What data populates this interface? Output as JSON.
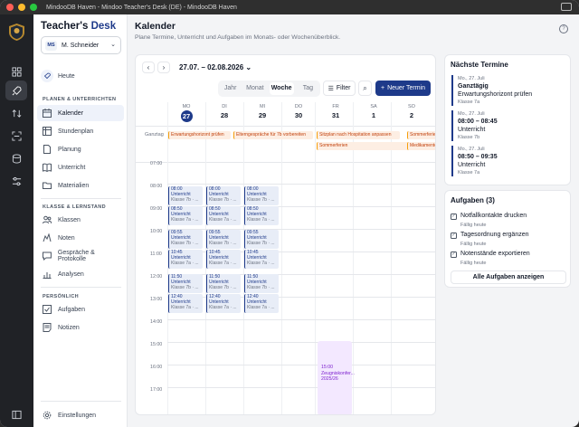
{
  "window": {
    "title": "MindooDB Haven - Mindoo Teacher's Desk (DE) - MindooDB Haven"
  },
  "sidebar": {
    "brand_plain": "Teacher's ",
    "brand_accent": "Desk",
    "user": {
      "initials": "MS",
      "name": "M. Schneider"
    },
    "home_label": "Heute",
    "sections": [
      {
        "title": "PLANEN & UNTERRICHTEN",
        "items": [
          "Kalender",
          "Stundenplan",
          "Planung",
          "Unterricht",
          "Materialien"
        ]
      },
      {
        "title": "KLASSE & LERNSTAND",
        "items": [
          "Klassen",
          "Noten",
          "Gespräche & Protokolle",
          "Analysen"
        ]
      },
      {
        "title": "PERSÖNLICH",
        "items": [
          "Aufgaben",
          "Notizen"
        ]
      }
    ],
    "settings_label": "Einstellungen"
  },
  "header": {
    "title": "Kalender",
    "subtitle": "Plane Termine, Unterricht und Aufgaben im Monats- oder Wochenüberblick."
  },
  "calendar": {
    "date_range": "27.07. – 02.08.2026",
    "views": [
      "Jahr",
      "Monat",
      "Woche",
      "Tag"
    ],
    "active_view": "Woche",
    "filter_label": "Filter",
    "new_label": "Neuer Termin",
    "allday_label": "Ganztag",
    "days": [
      {
        "name": "MO",
        "date": "27",
        "today": true
      },
      {
        "name": "DI",
        "date": "28"
      },
      {
        "name": "MI",
        "date": "29"
      },
      {
        "name": "DO",
        "date": "30"
      },
      {
        "name": "FR",
        "date": "31"
      },
      {
        "name": "SA",
        "date": "1"
      },
      {
        "name": "SO",
        "date": "2"
      }
    ],
    "allday_events": [
      "Erwartungshorizont prüfen",
      "Elterngespräche für 7b vorbereiten",
      "Sitzplan nach Hospitation anpassen",
      "Sommerferien",
      "Sommerferien",
      "Medikamente"
    ],
    "times": [
      "07:00",
      "08:00",
      "09:00",
      "10:00",
      "11:00",
      "12:00",
      "13:00",
      "14:00",
      "15:00",
      "16:00",
      "17:00"
    ],
    "lesson": {
      "title": "Unterricht",
      "times": [
        "08:00",
        "08:50",
        "09:55",
        "10:45",
        "11:50",
        "12:40"
      ],
      "class_prefix": "Klasse 7"
    },
    "purple_event": {
      "time": "15:00",
      "title": "Zeugniskonfer...",
      "year": "2025/26"
    }
  },
  "upcoming": {
    "title": "Nächste Termine",
    "items": [
      {
        "date": "Mo., 27. Juli",
        "time": "Ganztägig",
        "title": "Erwartungshorizont prüfen",
        "class": "Klasse 7a"
      },
      {
        "date": "Mo., 27. Juli",
        "time": "08:00 – 08:45",
        "title": "Unterricht",
        "class": "Klasse 7b"
      },
      {
        "date": "Mo., 27. Juli",
        "time": "08:50 – 09:35",
        "title": "Unterricht",
        "class": "Klasse 7a"
      }
    ]
  },
  "tasks": {
    "title": "Aufgaben (3)",
    "items": [
      {
        "title": "Notfallkontakte drucken",
        "due": "Fällig heute"
      },
      {
        "title": "Tagesordnung ergänzen",
        "due": "Fällig heute"
      },
      {
        "title": "Notenstände exportieren",
        "due": "Fällig heute"
      }
    ],
    "all_label": "Alle Aufgaben anzeigen"
  },
  "colors": {
    "accent": "#1e3a8a",
    "lesson_bg": "#e8edf7",
    "allday_bg": "#fdeee3",
    "purple_bg": "#f3e8ff"
  }
}
